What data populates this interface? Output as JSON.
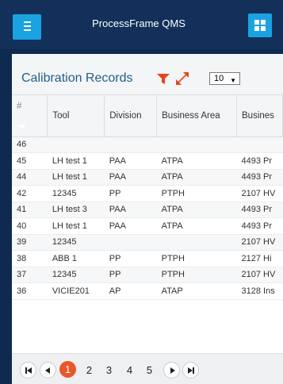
{
  "header": {
    "title": "ProcessFrame QMS",
    "menu_icon": "hamburger-icon",
    "apps_icon": "grid-icon"
  },
  "panel": {
    "title": "Calibration Records",
    "filter_icon": "filter-icon",
    "expand_icon": "expand-icon",
    "page_size": "10"
  },
  "table": {
    "columns": [
      "#",
      "Tool",
      "Division",
      "Business Area",
      "Busines"
    ],
    "rows": [
      [
        "46",
        "",
        "",
        "",
        ""
      ],
      [
        "45",
        "LH test 1",
        "PAA",
        "ATPA",
        "4493 Pr"
      ],
      [
        "44",
        "LH test 1",
        "PAA",
        "ATPA",
        "4493 Pr"
      ],
      [
        "42",
        "12345",
        "PP",
        "PTPH",
        "2107 HV"
      ],
      [
        "41",
        "LH test 3",
        "PAA",
        "ATPA",
        "4493 Pr"
      ],
      [
        "40",
        "LH test 1",
        "PAA",
        "ATPA",
        "4493 Pr"
      ],
      [
        "39",
        "12345",
        "",
        "",
        "2107 HV"
      ],
      [
        "38",
        "ABB 1",
        "PP",
        "PTPH",
        "2127 Hi"
      ],
      [
        "37",
        "12345",
        "PP",
        "PTPH",
        "2107 HV"
      ],
      [
        "36",
        "VICIE201",
        "AP",
        "ATAP",
        "3128 Ins"
      ]
    ]
  },
  "pagination": {
    "pages": [
      "1",
      "2",
      "3",
      "4",
      "5"
    ],
    "current": "1"
  },
  "colors": {
    "accent": "#1aa3e0",
    "background": "#0f2a4f",
    "header": "#12305a",
    "title_text": "#1f5f8a",
    "filter": "#e8441c",
    "active_page": "#e8562a"
  }
}
